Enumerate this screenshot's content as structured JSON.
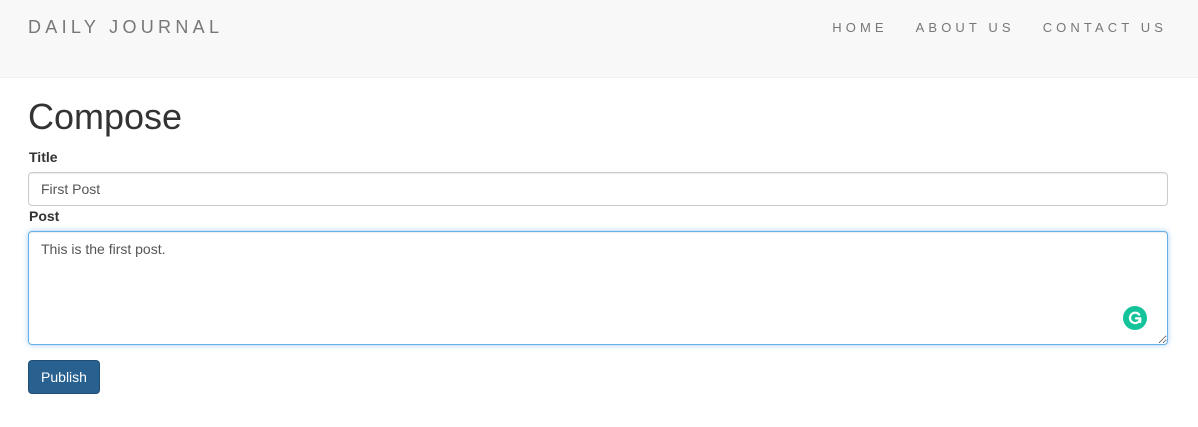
{
  "navbar": {
    "brand": "DAILY JOURNAL",
    "links": [
      {
        "label": "HOME"
      },
      {
        "label": "ABOUT US"
      },
      {
        "label": "CONTACT US"
      }
    ]
  },
  "main": {
    "title": "Compose",
    "title_field": {
      "label": "Title",
      "value": "First Post"
    },
    "post_field": {
      "label": "Post",
      "value": "This is the first post."
    },
    "publish_label": "Publish"
  },
  "colors": {
    "navbar_background": "#f8f8f8",
    "nav_text": "#777777",
    "primary_button": "#286090",
    "focus_border": "#66afe9",
    "grammarly_badge": "#15c39a"
  },
  "icons": {
    "grammarly": "grammarly-icon"
  }
}
